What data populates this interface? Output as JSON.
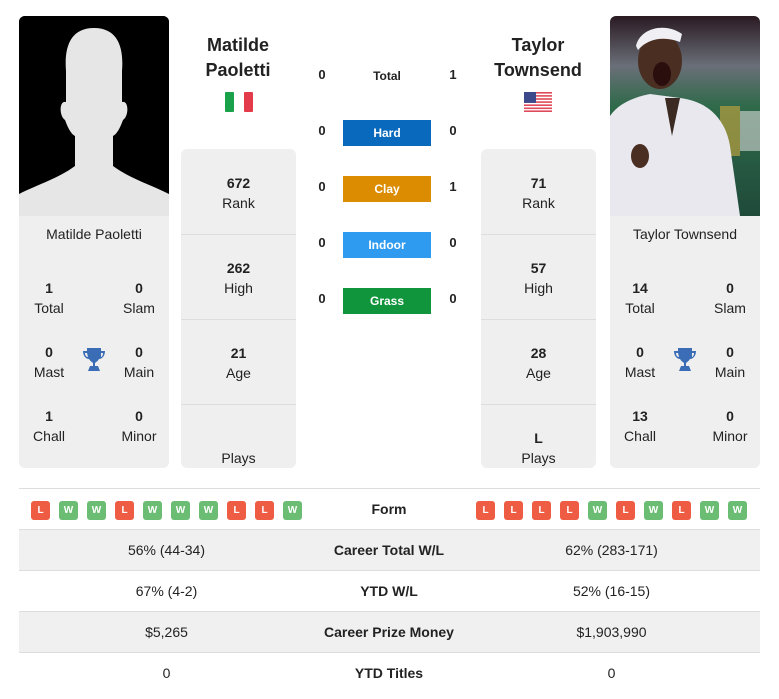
{
  "left": {
    "name": "Matilde Paoletti",
    "name_line1": "Matilde",
    "name_line2": "Paoletti",
    "country_flag": "italy-flag",
    "titles": {
      "total": "1",
      "total_label": "Total",
      "slam": "0",
      "slam_label": "Slam",
      "mast": "0",
      "mast_label": "Mast",
      "main": "0",
      "main_label": "Main",
      "chall": "1",
      "chall_label": "Chall",
      "minor": "0",
      "minor_label": "Minor"
    },
    "stats": [
      {
        "value": "672",
        "label": "Rank"
      },
      {
        "value": "262",
        "label": "High"
      },
      {
        "value": "21",
        "label": "Age"
      },
      {
        "value": "",
        "label": "Plays"
      }
    ],
    "form": [
      "L",
      "W",
      "W",
      "L",
      "W",
      "W",
      "W",
      "L",
      "L",
      "W"
    ]
  },
  "right": {
    "name": "Taylor Townsend",
    "name_line1": "Taylor",
    "name_line2": "Townsend",
    "country_flag": "usa-flag",
    "titles": {
      "total": "14",
      "total_label": "Total",
      "slam": "0",
      "slam_label": "Slam",
      "mast": "0",
      "mast_label": "Mast",
      "main": "0",
      "main_label": "Main",
      "chall": "13",
      "chall_label": "Chall",
      "minor": "0",
      "minor_label": "Minor"
    },
    "stats": [
      {
        "value": "71",
        "label": "Rank"
      },
      {
        "value": "57",
        "label": "High"
      },
      {
        "value": "28",
        "label": "Age"
      },
      {
        "value": "L",
        "label": "Plays"
      }
    ],
    "form": [
      "L",
      "L",
      "L",
      "L",
      "W",
      "L",
      "W",
      "L",
      "W",
      "W"
    ]
  },
  "h2h": [
    {
      "label": "Total",
      "left": "0",
      "right": "1",
      "color": null
    },
    {
      "label": "Hard",
      "left": "0",
      "right": "0",
      "color": "#0869bd"
    },
    {
      "label": "Clay",
      "left": "0",
      "right": "1",
      "color": "#db8c00"
    },
    {
      "label": "Indoor",
      "left": "0",
      "right": "0",
      "color": "#2f9bf0"
    },
    {
      "label": "Grass",
      "left": "0",
      "right": "0",
      "color": "#10943c"
    }
  ],
  "form_label": "Form",
  "colors": {
    "win": "#6cbd74",
    "loss": "#ee5c43",
    "trophy": "#3a6db5"
  },
  "table": [
    {
      "label": "Career Total W/L",
      "left": "56% (44-34)",
      "right": "62% (283-171)"
    },
    {
      "label": "YTD W/L",
      "left": "67% (4-2)",
      "right": "52% (16-15)"
    },
    {
      "label": "Career Prize Money",
      "left": "$5,265",
      "right": "$1,903,990"
    },
    {
      "label": "YTD Titles",
      "left": "0",
      "right": "0"
    }
  ]
}
